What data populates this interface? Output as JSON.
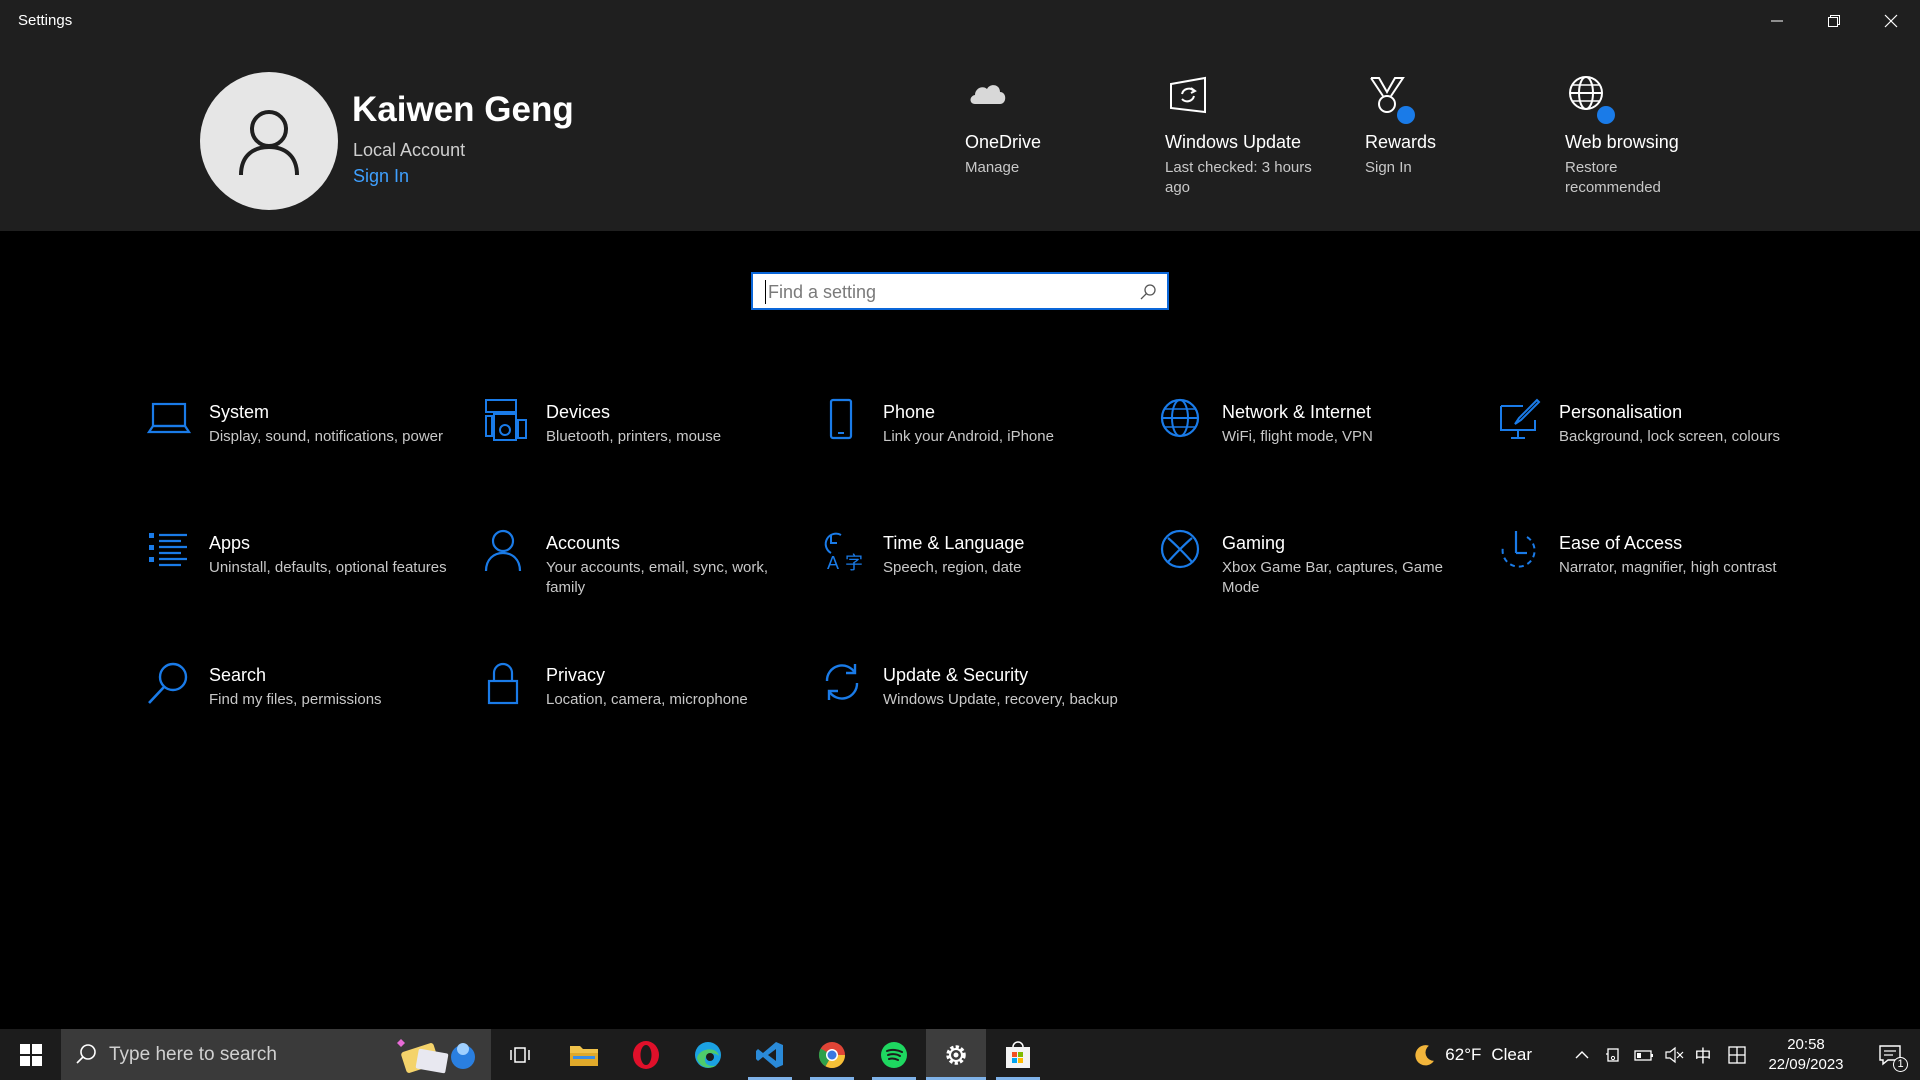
{
  "window": {
    "title": "Settings",
    "controls": {
      "minimize": "minimize-icon",
      "restore": "restore-icon",
      "close": "close-icon"
    }
  },
  "profile": {
    "name": "Kaiwen Geng",
    "account_type": "Local Account",
    "sign_in": "Sign In"
  },
  "quick_links": [
    {
      "title": "OneDrive",
      "subtitle": "Manage",
      "icon": "cloud-icon"
    },
    {
      "title": "Windows Update",
      "subtitle": "Last checked: 3 hours ago",
      "icon": "windows-update-icon"
    },
    {
      "title": "Rewards",
      "subtitle": "Sign In",
      "icon": "rewards-medal-icon"
    },
    {
      "title": "Web browsing",
      "subtitle": "Restore recommended",
      "icon": "globe-icon"
    }
  ],
  "search": {
    "placeholder": "Find a setting"
  },
  "categories": [
    {
      "label": "System",
      "description": "Display, sound, notifications, power",
      "icon": "laptop-icon"
    },
    {
      "label": "Devices",
      "description": "Bluetooth, printers, mouse",
      "icon": "devices-icon"
    },
    {
      "label": "Phone",
      "description": "Link your Android, iPhone",
      "icon": "phone-icon"
    },
    {
      "label": "Network & Internet",
      "description": "WiFi, flight mode, VPN",
      "icon": "globe-icon"
    },
    {
      "label": "Personalisation",
      "description": "Background, lock screen, colours",
      "icon": "paintbrush-icon"
    },
    {
      "label": "Apps",
      "description": "Uninstall, defaults, optional features",
      "icon": "apps-list-icon"
    },
    {
      "label": "Accounts",
      "description": "Your accounts, email, sync, work, family",
      "icon": "person-icon"
    },
    {
      "label": "Time & Language",
      "description": "Speech, region, date",
      "icon": "time-language-icon"
    },
    {
      "label": "Gaming",
      "description": "Xbox Game Bar, captures, Game Mode",
      "icon": "xbox-icon"
    },
    {
      "label": "Ease of Access",
      "description": "Narrator, magnifier, high contrast",
      "icon": "ease-of-access-icon"
    },
    {
      "label": "Search",
      "description": "Find my files, permissions",
      "icon": "search-icon"
    },
    {
      "label": "Privacy",
      "description": "Location, camera, microphone",
      "icon": "lock-icon"
    },
    {
      "label": "Update & Security",
      "description": "Windows Update, recovery, backup",
      "icon": "sync-icon"
    }
  ],
  "taskbar": {
    "search_placeholder": "Type here to search",
    "apps": [
      "start-icon",
      "task-view-icon",
      "file-explorer-icon",
      "opera-icon",
      "edge-icon",
      "vscode-icon",
      "chrome-icon",
      "spotify-icon",
      "settings-icon",
      "store-icon"
    ],
    "weather": {
      "temp": "62°F",
      "condition": "Clear"
    },
    "ime": "中",
    "time": "20:58",
    "date": "22/09/2023",
    "notification_count": "1"
  },
  "colors": {
    "accent": "#1a7be8",
    "link": "#3fa0ff",
    "header_bg": "#1f1f1f",
    "taskbar_bg": "#1c1c1c"
  }
}
